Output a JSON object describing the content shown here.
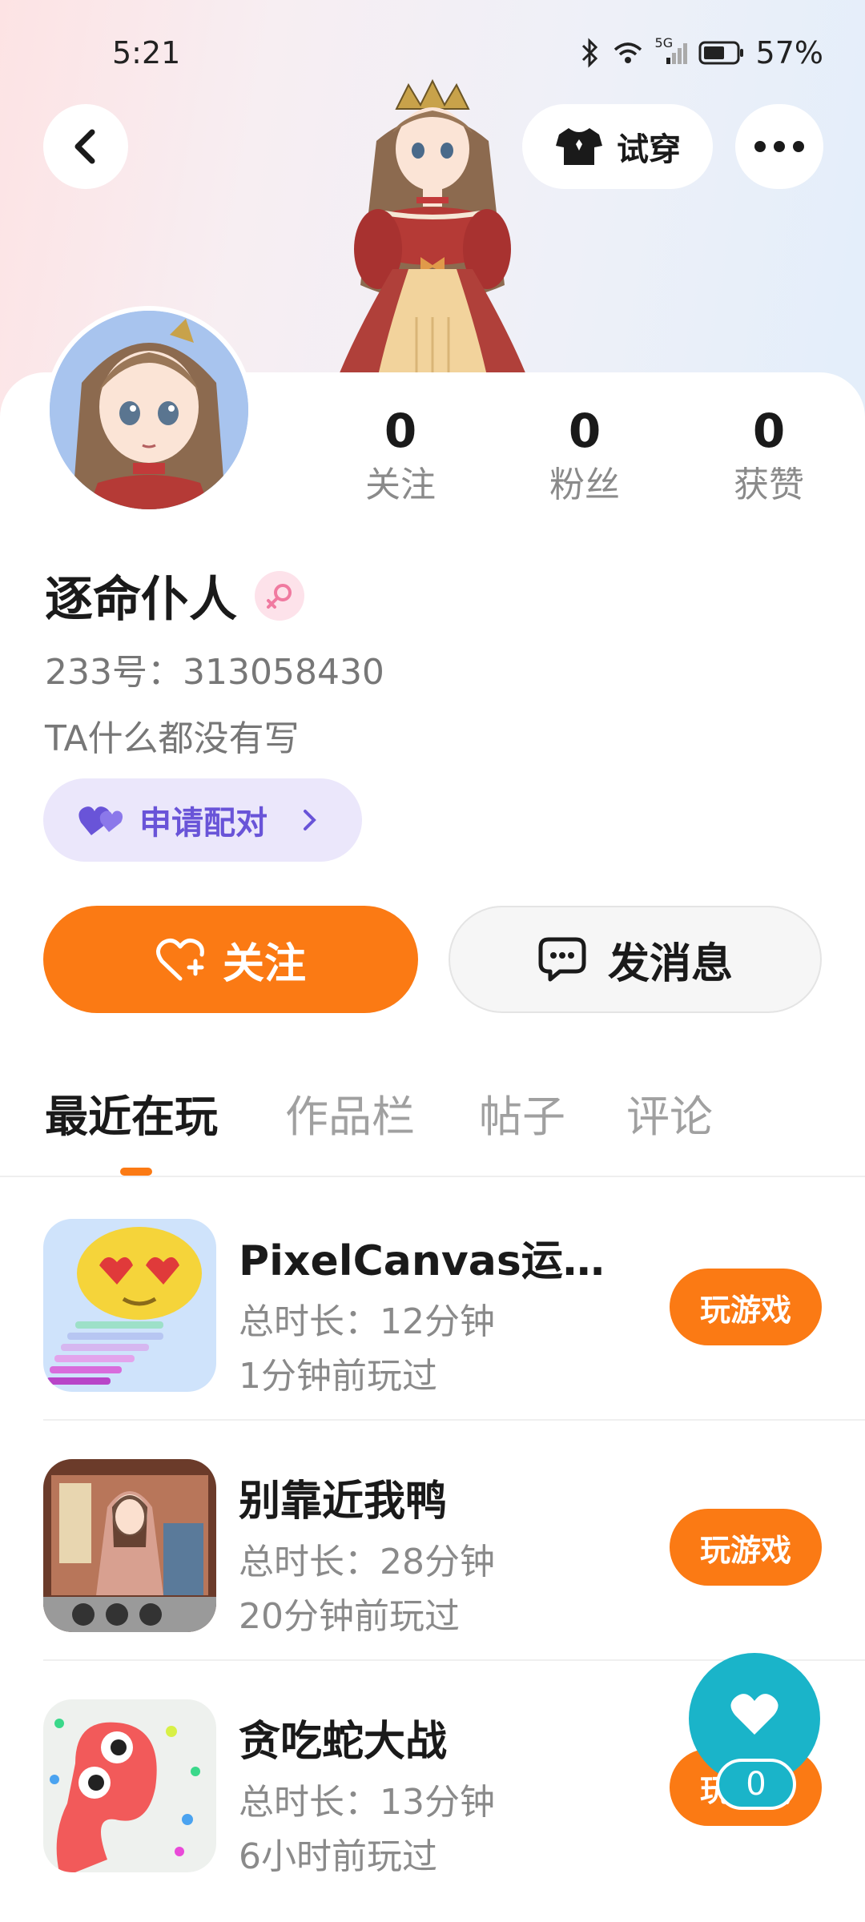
{
  "status_bar": {
    "time": "5:21",
    "network": "5G",
    "battery": "57%"
  },
  "header": {
    "try_on_label": "试穿"
  },
  "stats": [
    {
      "value": "0",
      "label": "关注"
    },
    {
      "value": "0",
      "label": "粉丝"
    },
    {
      "value": "0",
      "label": "获赞"
    }
  ],
  "profile": {
    "name": "逐命仆人",
    "gender": "female",
    "uid": "233号：313058430",
    "bio": "TA什么都没有写"
  },
  "pair_button": {
    "label": "申请配对"
  },
  "actions": {
    "follow_label": "关注",
    "message_label": "发消息"
  },
  "tabs": [
    {
      "label": "最近在玩",
      "active": true
    },
    {
      "label": "作品栏",
      "active": false
    },
    {
      "label": "帖子",
      "active": false
    },
    {
      "label": "评论",
      "active": false
    }
  ],
  "games": [
    {
      "title": "PixelCanvas运行…",
      "duration": "总时长：12分钟",
      "last_played": "1分钟前玩过",
      "play_label": "玩游戏",
      "icon": "emoji-pixel-icon"
    },
    {
      "title": "别靠近我鸭",
      "duration": "总时长：28分钟",
      "last_played": "20分钟前玩过",
      "play_label": "玩游戏",
      "icon": "palace-drama-icon"
    },
    {
      "title": "贪吃蛇大战",
      "duration": "总时长：13分钟",
      "last_played": "6小时前玩过",
      "play_label": "玩游戏",
      "icon": "snake-icon"
    }
  ],
  "like_fab": {
    "count": "0"
  },
  "colors": {
    "accent": "#fb7a14",
    "pair": "#6954d8",
    "fab": "#1ab4c9"
  }
}
